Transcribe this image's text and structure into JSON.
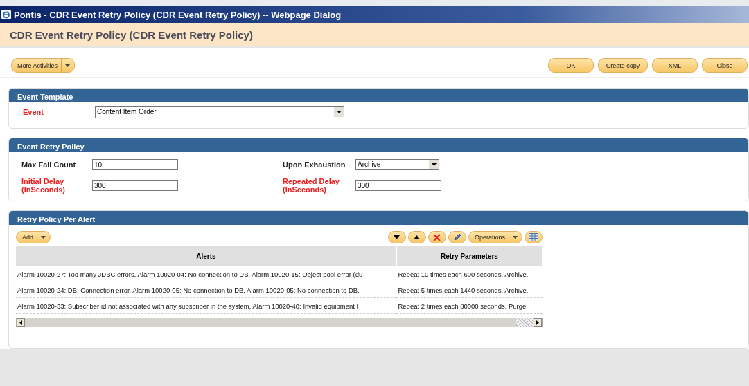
{
  "window": {
    "title": "Pontis - CDR Event Retry Policy (CDR Event Retry Policy) -- Webpage Dialog"
  },
  "page_title": "CDR Event Retry Policy (CDR Event Retry Policy)",
  "toolbar": {
    "menu_button": "More Activities",
    "buttons": [
      "OK",
      "Create copy",
      "XML",
      "Close"
    ]
  },
  "event_template": {
    "title": "Event Template",
    "fields": [
      {
        "label": "Event",
        "required": true,
        "kind": "select",
        "value": "Content Item Order"
      }
    ]
  },
  "event_retry_policy": {
    "title": "Event Retry Policy",
    "fields": [
      {
        "label": "Max Fail Count",
        "required": false,
        "kind": "text",
        "value": "10"
      },
      {
        "label": "Upon Exhaustion",
        "required": false,
        "kind": "select",
        "value": "Archive"
      },
      {
        "label": "Initial Delay (InSeconds)",
        "required": true,
        "kind": "text",
        "value": "300"
      },
      {
        "label": "Repeated Delay (InSeconds)",
        "required": true,
        "kind": "text",
        "value": "300"
      }
    ]
  },
  "retry_policy_per_alert": {
    "title": "Retry Policy Per Alert",
    "add_button": "Add",
    "operations_button": "Operations",
    "table": {
      "columns": [
        "Alerts",
        "Retry Parameters"
      ],
      "rows": [
        [
          "Alarm 10020-27: Too many JDBC errors, Alarm 10020-04: No connection to DB, Alarm 10020-15: Object pool error (du",
          "Repeat 10 times each 600 seconds. Archive."
        ],
        [
          "Alarm 10020-24: DB: Connection error, Alarm 10020-05: No connection to DB, Alarm 10020-05: No connection to DB,",
          "Repeat 5 times each 1440 seconds. Archive."
        ],
        [
          "Alarm 10020-33: Subscriber id not associated with any subscriber in the system, Alarm 10020-40: Invalid equipment I",
          "Repeat 2 times each 80000 seconds. Purge."
        ]
      ]
    }
  }
}
